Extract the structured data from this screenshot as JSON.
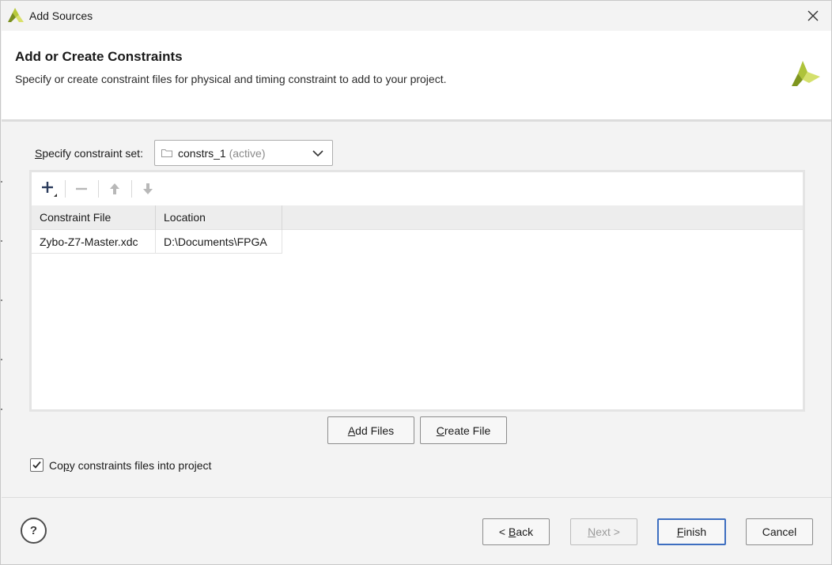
{
  "window": {
    "title": "Add Sources"
  },
  "header": {
    "title": "Add or Create Constraints",
    "subtitle": "Specify or create constraint files for physical and timing constraint to add to your project."
  },
  "constraint_set": {
    "label_mnemonic": "S",
    "label_rest": "pecify constraint set:",
    "selected": "constrs_1",
    "selected_suffix": "(active)"
  },
  "toolbar": {
    "icons": [
      "plus-icon",
      "minus-icon",
      "arrow-up-icon",
      "arrow-down-icon"
    ]
  },
  "table": {
    "columns": [
      "Constraint File",
      "Location"
    ],
    "rows": [
      [
        "Zybo-Z7-Master.xdc",
        "D:\\Documents\\FPGA"
      ]
    ]
  },
  "actions": {
    "add_files_mnemonic": "A",
    "add_files_rest": "dd Files",
    "create_file_mnemonic": "C",
    "create_file_rest": "reate File"
  },
  "copy_checkbox": {
    "checked": true,
    "label_pre": "Co",
    "label_mnemonic": "p",
    "label_post": "y constraints files into project"
  },
  "footer": {
    "help": "?",
    "back_pre": "< ",
    "back_mnemonic": "B",
    "back_post": "ack",
    "next_mnemonic": "N",
    "next_post": "ext >",
    "finish_mnemonic": "F",
    "finish_post": "inish",
    "cancel": "Cancel"
  },
  "colors": {
    "accent": "#3d6ec0",
    "logo_green": "#9cb52c",
    "header_bg": "#ffffff",
    "dialog_bg": "#f3f3f3"
  }
}
